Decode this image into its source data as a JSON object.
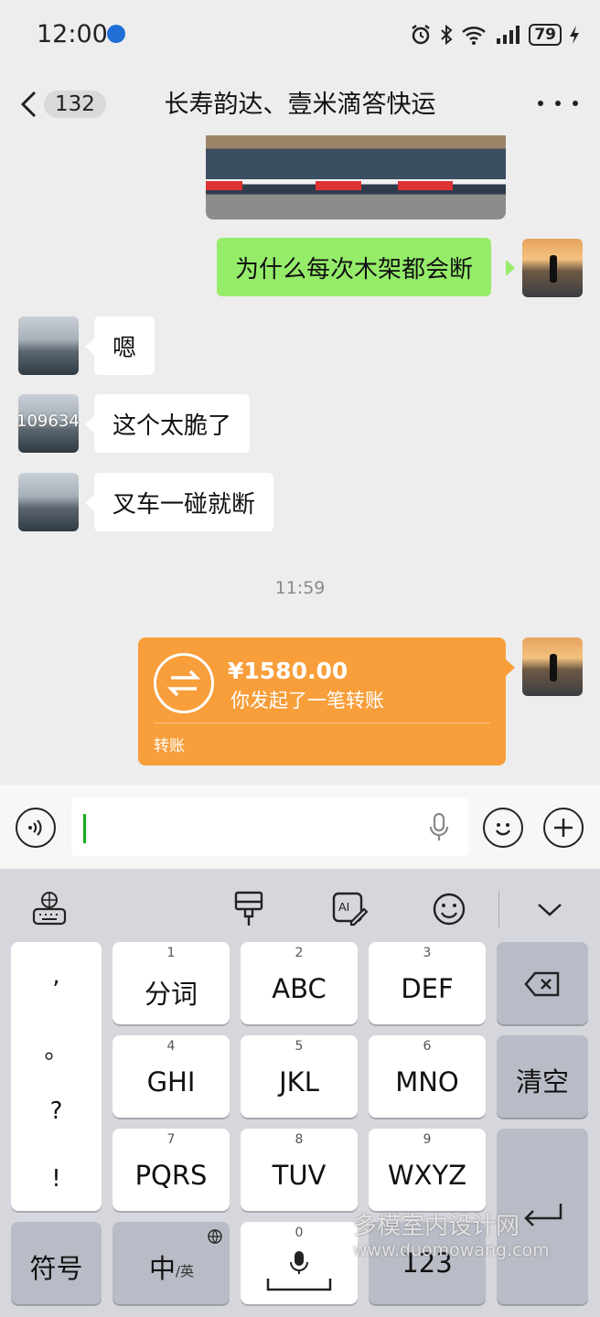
{
  "status_bar": {
    "time": "12:00",
    "battery": "79"
  },
  "nav": {
    "unread_count": "132",
    "title": "长寿韵达、壹米滴答快运"
  },
  "messages": {
    "sent_1": "为什么每次木架都会断",
    "recv_1": "嗯",
    "recv_2": "这个太脆了",
    "recv_3": "叉车一碰就断",
    "avatar_overlay_number": "109634",
    "timestamp": "11:59"
  },
  "transfer": {
    "amount": "¥1580.00",
    "description": "你发起了一笔转账",
    "label": "转账"
  },
  "keyboard": {
    "punctuation": [
      ",",
      "。",
      "?",
      "!"
    ],
    "rows": [
      [
        {
          "num": "1",
          "label": "分词"
        },
        {
          "num": "2",
          "label": "ABC"
        },
        {
          "num": "3",
          "label": "DEF"
        }
      ],
      [
        {
          "num": "4",
          "label": "GHI"
        },
        {
          "num": "5",
          "label": "JKL"
        },
        {
          "num": "6",
          "label": "MNO"
        }
      ],
      [
        {
          "num": "7",
          "label": "PQRS"
        },
        {
          "num": "8",
          "label": "TUV"
        },
        {
          "num": "9",
          "label": "WXYZ"
        }
      ]
    ],
    "clear_label": "清空",
    "symbols_label": "符号",
    "lang_label_main": "中",
    "lang_label_sub": "/英",
    "space_num": "0",
    "num_label": "123"
  },
  "watermark": {
    "line1": "多模室内设计网",
    "line2": "www.duomowang.com"
  },
  "colors": {
    "sent_bubble": "#95ec69",
    "transfer": "#f89e3a",
    "caret": "#1aad19"
  }
}
